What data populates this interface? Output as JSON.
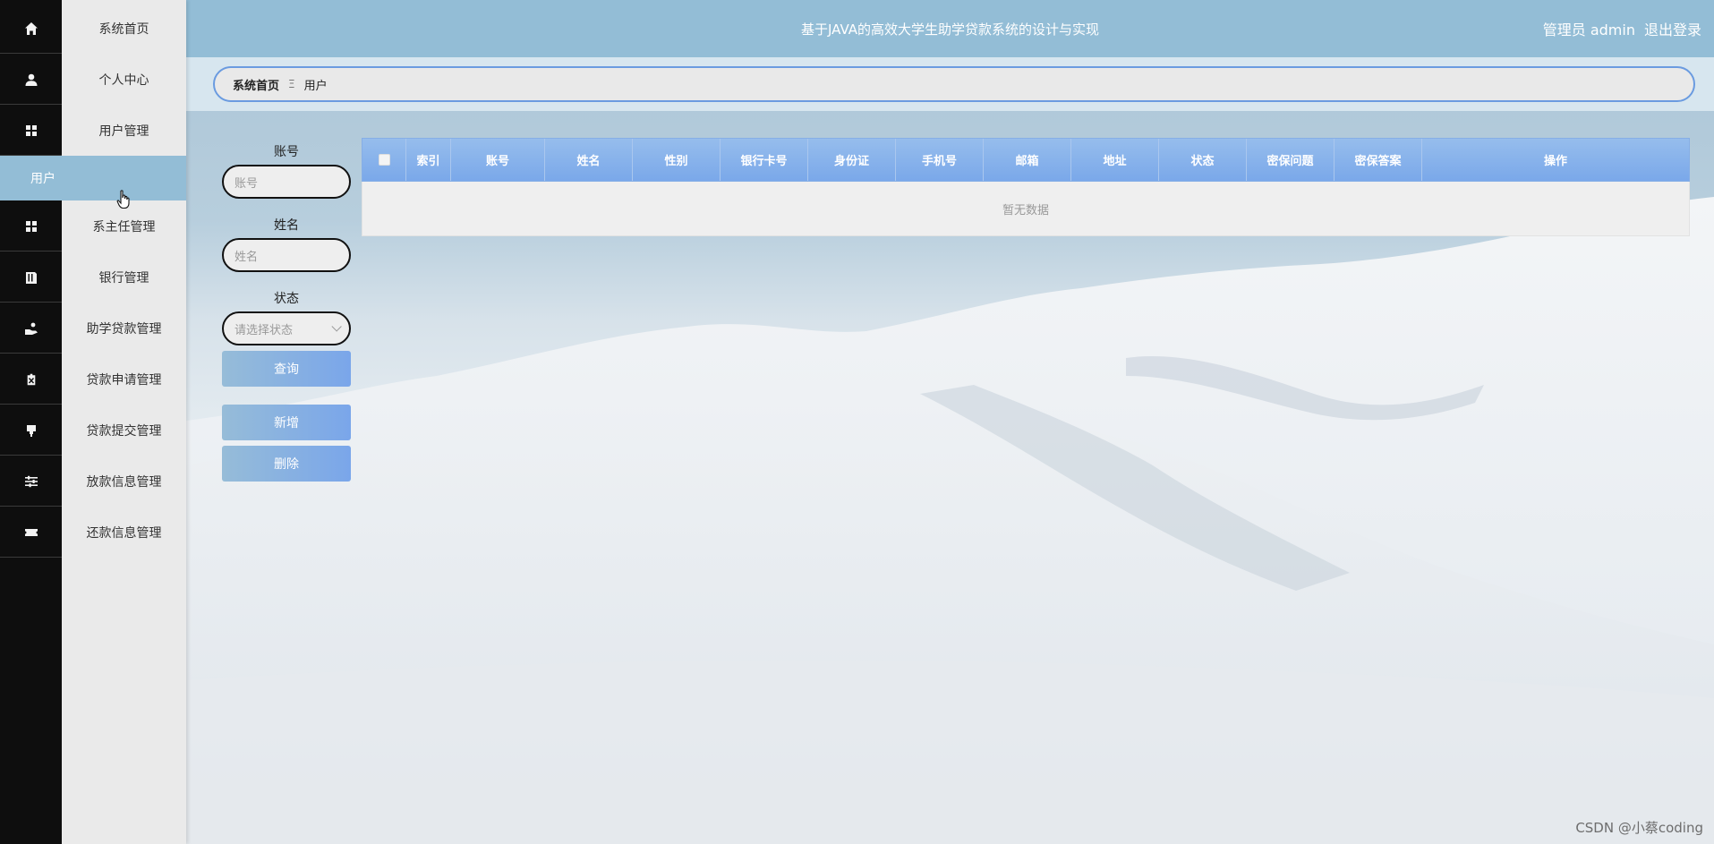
{
  "sidebar": {
    "items": [
      {
        "label": "系统首页",
        "icon": "home-icon"
      },
      {
        "label": "个人中心",
        "icon": "person-icon"
      },
      {
        "label": "用户管理",
        "icon": "grid-icon"
      },
      {
        "label": "系主任管理",
        "icon": "grid-icon"
      },
      {
        "label": "银行管理",
        "icon": "book-icon"
      },
      {
        "label": "助学贷款管理",
        "icon": "hand-coin-icon"
      },
      {
        "label": "贷款申请管理",
        "icon": "clipboard-icon"
      },
      {
        "label": "贷款提交管理",
        "icon": "stamp-icon"
      },
      {
        "label": "放款信息管理",
        "icon": "sliders-icon"
      },
      {
        "label": "还款信息管理",
        "icon": "ticket-icon"
      }
    ],
    "active_sub_item": "用户"
  },
  "header": {
    "title": "基于JAVA的高效大学生助学贷款系统的设计与实现",
    "user_label": "管理员 admin",
    "logout_label": "退出登录"
  },
  "breadcrumb": {
    "home": "系统首页",
    "separator": "Ξ",
    "current": "用户"
  },
  "search": {
    "account_label": "账号",
    "account_placeholder": "账号",
    "name_label": "姓名",
    "name_placeholder": "姓名",
    "status_label": "状态",
    "status_placeholder": "请选择状态",
    "query_button": "查询",
    "add_button": "新增",
    "delete_button": "删除"
  },
  "table": {
    "columns": [
      "索引",
      "账号",
      "姓名",
      "性别",
      "银行卡号",
      "身份证",
      "手机号",
      "邮箱",
      "地址",
      "状态",
      "密保问题",
      "密保答案",
      "操作"
    ],
    "empty_text": "暂无数据"
  },
  "watermark": "CSDN @小蔡coding",
  "colors": {
    "sidebar_icon_strip": "#0e0e0e",
    "topbar": "#93bdd6",
    "active_sub_item": "#93bdd6",
    "table_header": "#7aa8ea",
    "button_gradient_start": "#96bcd8",
    "button_gradient_end": "#7aa6ea",
    "breadcrumb_border": "#6a9be0"
  }
}
